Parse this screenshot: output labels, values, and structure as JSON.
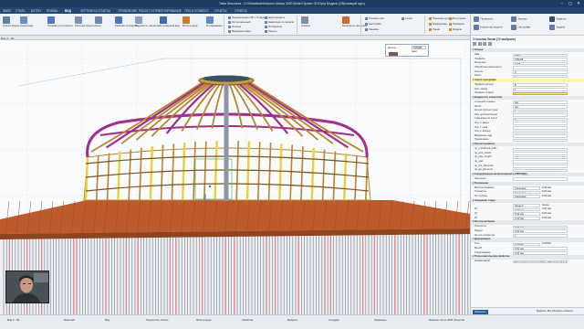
{
  "window": {
    "title": "Tekla Structures - D:\\TeklaModels\\Купол Шатер 2020 Model Проект 02 Юрта Модель (Обучающий курс)",
    "controls": [
      "–",
      "▢",
      "✕"
    ]
  },
  "ribbon_tabs": [
    "ФАЙЛ",
    "СТАЛЬ",
    "БЕТОН",
    "ПРАВКА",
    "ВИД",
    "ЧЕРТЕЖИ И ОТЧЕТЫ",
    "УПРАВЛЕНИЕ",
    "РАСЧЕТ И ПРОЕКТИРОВАНИЕ",
    "TEKLA CONNECT",
    "ОТЧЕТЫ",
    "ОТМЕНА"
  ],
  "active_tab_index": 4,
  "ribbon": {
    "large_buttons": [
      {
        "label": "Список видов",
        "color": "#5f7ea5"
      },
      {
        "label": "Новый вид",
        "color": "#6b8fbd"
      },
      {
        "label": "Показать по плоскости",
        "color": "#4f7cb8"
      },
      {
        "label": "Рабочая область",
        "color": "#7a93b5"
      },
      {
        "label": "Окна",
        "color": "#6d87aa"
      },
      {
        "label": "Рабочая плоскость",
        "color": "#4b78b0"
      },
      {
        "label": "Видимость объектов",
        "color": "#8aa0bf"
      },
      {
        "label": "Трехмерный вид",
        "color": "#3f6aa3"
      },
      {
        "label": "Фильтр вида",
        "color": "#c77d2b"
      },
      {
        "label": "Отображение",
        "color": "#5d8cc8"
      },
      {
        "label": "Снимок",
        "color": "#7b90aa"
      },
      {
        "label": "Выполнить проверку",
        "color": "#d06a2c"
      }
    ],
    "small_buttons": [
      "Перемещение (3D + 5 кадров)",
      "Ортогональный",
      "Отмена",
      "Вращение вида",
      "Центрировать",
      "Навигация по модели",
      "Отобразить",
      "Скрыть",
      "Показать все",
      "Настройки",
      "Линейка",
      "Сетка"
    ],
    "right_buttons": [
      "Проекция детали",
      "Маркировка",
      "Линия",
      "Полилиния",
      "Проверка",
      "Модели"
    ]
  },
  "doc_tab": "Вид 3 - 3D",
  "float_panel": {
    "row1_label": "Деталь",
    "row1_value": "TMCAB",
    "row2_label": "Цвет",
    "swatch_color": "#9a4a2e"
  },
  "right_panel": {
    "header_buttons": [
      "Проверить",
      "Корректор модели",
      "Журнал",
      "Настройки",
      "Закрыть",
      "Задача"
    ],
    "title": "Стальная балка (10 выбрано)",
    "rows": [
      {
        "kind": "sec",
        "k": "Общее"
      },
      {
        "kind": "p",
        "k": "Имя",
        "v": "ДУГА"
      },
      {
        "kind": "p",
        "k": "Профиль",
        "v": "TMCAB"
      },
      {
        "kind": "p",
        "k": "Материал",
        "v": "S235"
      },
      {
        "kind": "p",
        "k": "Обработка поверхности",
        "v": ""
      },
      {
        "kind": "p",
        "k": "Конечн.",
        "v": "4"
      },
      {
        "kind": "p",
        "k": "Класс",
        "v": "2"
      },
      {
        "kind": "sec",
        "k": "Серия нумерации",
        "hl": true
      },
      {
        "kind": "p",
        "k": "Префикс детали",
        "v": "B"
      },
      {
        "kind": "p",
        "k": "Нач. номер",
        "v": "1"
      },
      {
        "kind": "p",
        "k": "Префикс сборки",
        "v": "A",
        "yellow": true
      },
      {
        "kind": "sec",
        "k": "Видимость элементов"
      },
      {
        "kind": "p",
        "k": "Стальной элемент",
        "v": "Нет"
      },
      {
        "kind": "p",
        "k": "Изгиб",
        "v": "Нет"
      },
      {
        "kind": "p",
        "k": "Кол-во пустых строк",
        "v": "1"
      },
      {
        "kind": "p",
        "k": "Имя дополнительно",
        "v": ""
      },
      {
        "kind": "p",
        "k": "Смещение по оси Z",
        "v": "0"
      },
      {
        "kind": "p",
        "k": "Ось X, вверх",
        "v": ""
      },
      {
        "kind": "p",
        "k": "Ось Y, вниз",
        "v": ""
      },
      {
        "kind": "p",
        "k": "Ось Z, вперед",
        "v": ""
      },
      {
        "kind": "p",
        "k": "Вращение, вид",
        "v": ""
      },
      {
        "kind": "p",
        "k": "Примечание",
        "v": ""
      },
      {
        "kind": "sec",
        "k": "Проектирование"
      },
      {
        "kind": "p",
        "k": "np_predefined_ends",
        "v": ""
      },
      {
        "kind": "p",
        "k": "np_joint_check",
        "v": ""
      },
      {
        "kind": "p",
        "k": "np_pipe_lenght",
        "v": ""
      },
      {
        "kind": "p",
        "k": "np_stair",
        "v": ""
      },
      {
        "kind": "p",
        "k": "np_fire_elements",
        "v": ""
      },
      {
        "kind": "p",
        "k": "np_ga_elements",
        "v": ""
      },
      {
        "kind": "sec",
        "k": "Спецификации металлопроката (ГМП/ОДС)"
      },
      {
        "kind": "p",
        "k": "Категория",
        "v": ""
      },
      {
        "kind": "sec",
        "k": "Положение"
      },
      {
        "kind": "p",
        "k": "Местоположение",
        "v": "Середина",
        "v2": "0.00 мм"
      },
      {
        "kind": "p",
        "k": "Плоскость",
        "v": "Середина",
        "v2": "0.00 мм"
      },
      {
        "kind": "p",
        "k": "По глубине",
        "v": "Середина",
        "v2": "0.00 мм"
      },
      {
        "kind": "sec",
        "k": "Смещение торца"
      },
      {
        "kind": "p",
        "k": "",
        "v": "Начало",
        "v2": "Конец"
      },
      {
        "kind": "p",
        "k": "Dx",
        "v": "0.00 мм",
        "v2": "0.00 мм"
      },
      {
        "kind": "p",
        "k": "Dy",
        "v": "0.00 мм",
        "v2": "0.00 мм"
      },
      {
        "kind": "p",
        "k": "Dz",
        "v": "0.00 мм",
        "v2": "0.00 мм"
      },
      {
        "kind": "sec",
        "k": "Изогнутая балка"
      },
      {
        "kind": "p",
        "k": "Плоскость",
        "v": "0.00 мм"
      },
      {
        "kind": "p",
        "k": "Радиус",
        "v": "0.00 мм"
      },
      {
        "kind": "p",
        "k": "Кол-во сегментов",
        "v": "1"
      },
      {
        "kind": "sec",
        "k": "Деформация"
      },
      {
        "kind": "p",
        "k": "Угол",
        "v": "0.00000",
        "v2": "0.00000"
      },
      {
        "kind": "p",
        "k": "Выгиб",
        "v": "0.00 мм"
      },
      {
        "kind": "p",
        "k": "Укорачивание",
        "v": "0.00 мм"
      },
      {
        "kind": "sec",
        "k": "Пользовательские свойства"
      },
      {
        "kind": "p",
        "k": "Комментарий",
        "v": "Пользовательские атрибуты (Постоянный выбранный к)"
      }
    ],
    "footer": {
      "modify": "Изменить",
      "selection": "Выбрать: Все | Выбрать объекты"
    }
  },
  "statusbar": {
    "items": [
      "Вид 3 - 3D",
      "Масштаб",
      "Вид",
      "Подсветить объект",
      "Фильтр вида",
      "Свойства",
      "Выбрать",
      "Стандарт",
      "Привязать"
    ],
    "message": "Выбрано 10 из 2836 объектов"
  },
  "colors": {
    "accent": "#1d3a5f",
    "wood": "#b8862f",
    "wood_dark": "#7a5620",
    "magenta": "#a02e8c",
    "selection_yellow": "#e8d23a",
    "platform": "#bd5b2c"
  }
}
